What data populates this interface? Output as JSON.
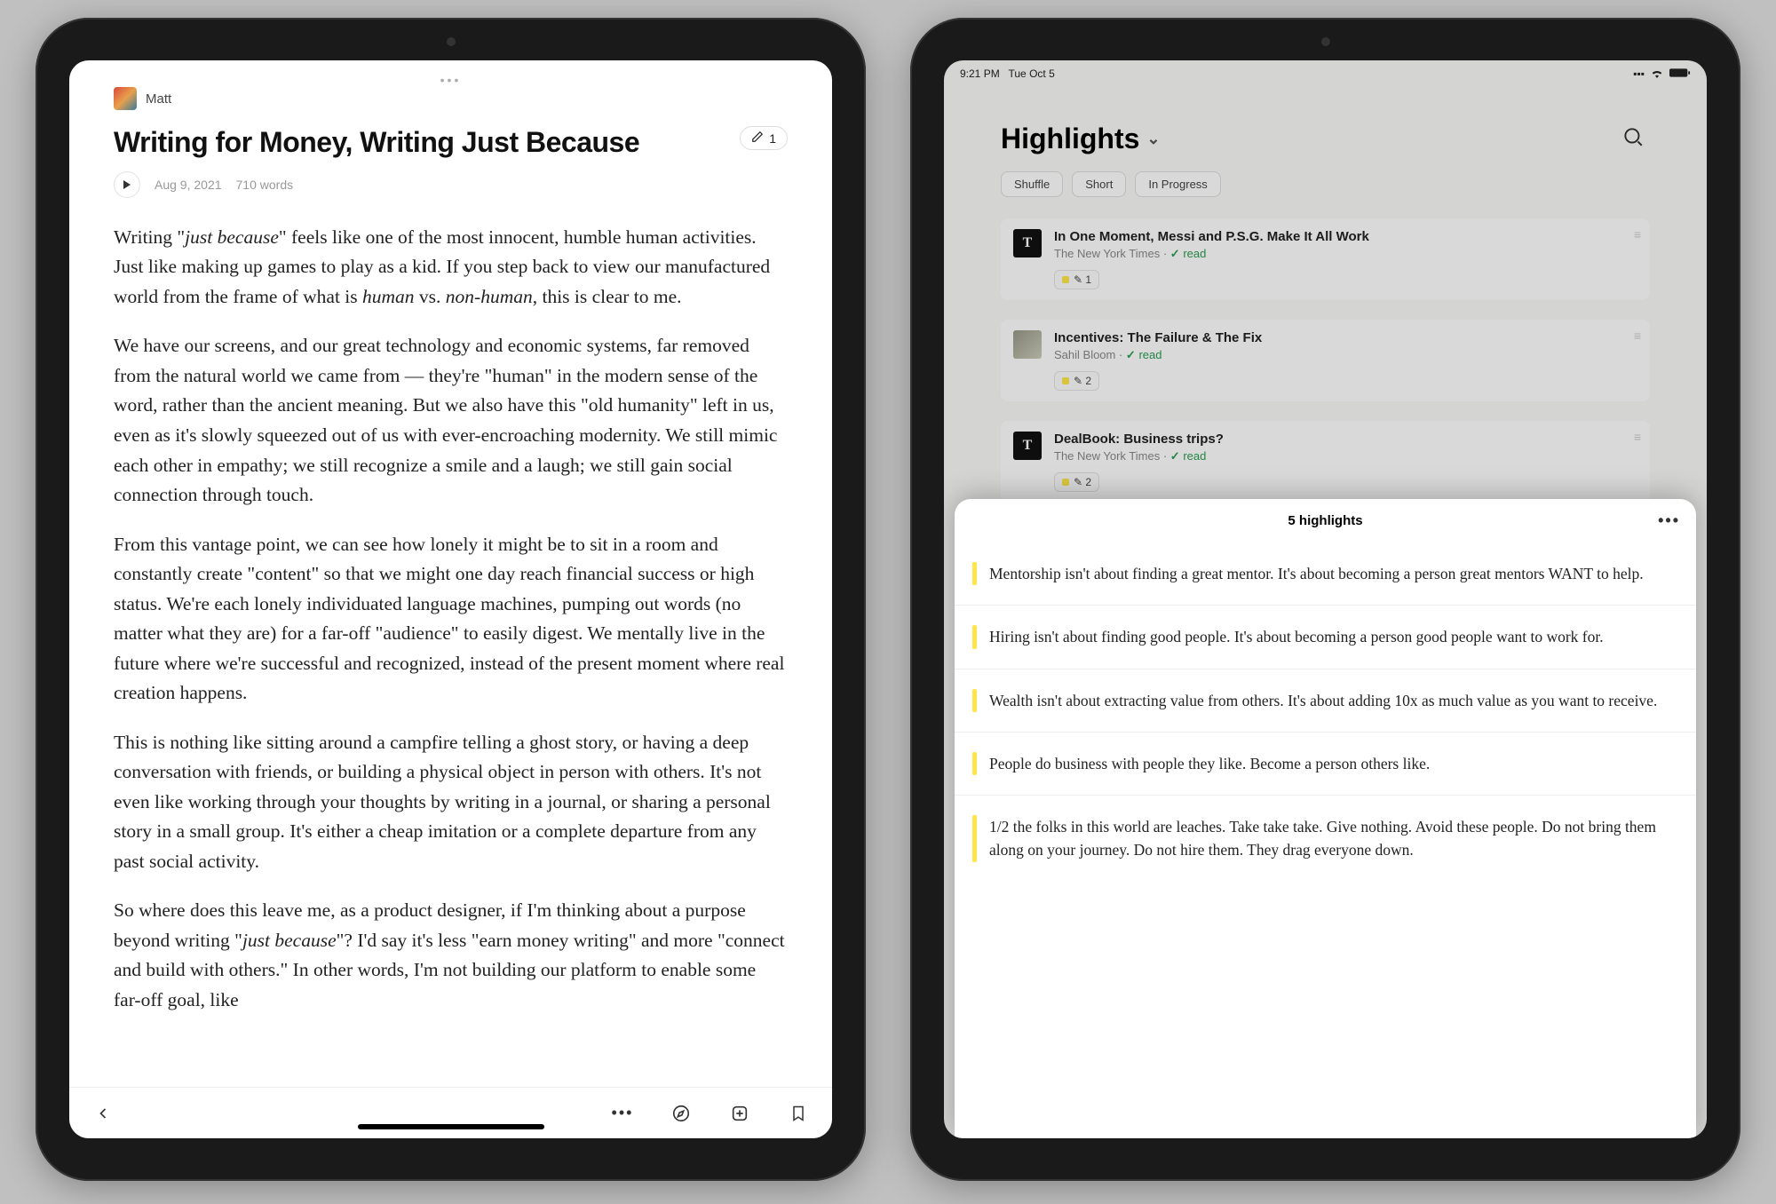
{
  "left": {
    "author": "Matt",
    "title": "Writing for Money, Writing Just Because",
    "edit_count": "1",
    "date": "Aug 9, 2021",
    "words": "710 words",
    "p1_a": "Writing \"",
    "p1_em": "just because",
    "p1_b": "\" feels like one of the most innocent, humble human activities. Just like making up games to play as a kid. If you step back to view our manufactured world from the frame of what is ",
    "p1_em2": "human",
    "p1_c": " vs. ",
    "p1_em3": "non-human",
    "p1_d": ", this is clear to me.",
    "p2": "We have our screens, and our great technology and economic systems, far removed from the natural world we came from — they're \"human\" in the modern sense of the word, rather than the ancient meaning. But we also have this \"old humanity\" left in us, even as it's slowly squeezed out of us with ever-encroaching modernity. We still mimic each other in empathy; we still recognize a smile and a laugh; we still gain social connection through touch.",
    "p3": "From this vantage point, we can see how lonely it might be to sit in a room and constantly create \"content\" so that we might one day reach financial success or high status. We're each lonely individuated language machines, pumping out words (no matter what they are) for a far-off \"audience\" to easily digest. We mentally live in the future where we're successful and recognized, instead of the present moment where real creation happens.",
    "p4": "This is nothing like sitting around a campfire telling a ghost story, or having a deep conversation with friends, or building a physical object in person with others. It's not even like working through your thoughts by writing in a journal, or sharing a personal story in a small group. It's either a cheap imitation or a complete departure from any past social activity.",
    "p5_a": "So where does this leave me, as a product designer, if I'm thinking about a purpose beyond writing \"",
    "p5_em": "just because",
    "p5_b": "\"? I'd say it's less \"earn money writing\" and more \"connect and build with others.\" In other words, I'm not building our platform to enable some far-off goal, like"
  },
  "right": {
    "status_time": "9:21 PM",
    "status_date": "Tue Oct 5",
    "page_title": "Highlights",
    "filters": [
      "Shuffle",
      "Short",
      "In Progress"
    ],
    "cards": [
      {
        "thumb": "T",
        "thumbType": "nyt",
        "title": "In One Moment, Messi and P.S.G. Make It All Work",
        "source": "The New York Times",
        "read": "read",
        "badge": "1"
      },
      {
        "thumb": "",
        "thumbType": "photo",
        "title": "Incentives: The Failure & The Fix",
        "source": "Sahil Bloom",
        "read": "read",
        "badge": "2"
      },
      {
        "thumb": "T",
        "thumbType": "nyt",
        "title": "DealBook: Business trips?",
        "source": "The New York Times",
        "read": "read",
        "badge": "2"
      }
    ],
    "sheet_title": "5 highlights",
    "highlights": [
      "Mentorship isn't about finding a great mentor. It's about becoming a person great mentors WANT to help.",
      "Hiring isn't about finding good people. It's about becoming a person good people want to work for.",
      "Wealth isn't about extracting value from others. It's about adding 10x as much value as you want to receive.",
      "People do business with people they like. Become a person others like.",
      "1/2 the folks in this world are leaches. Take take take. Give nothing. Avoid these people. Do not bring them along on your journey. Do not hire them. They drag everyone down."
    ]
  }
}
